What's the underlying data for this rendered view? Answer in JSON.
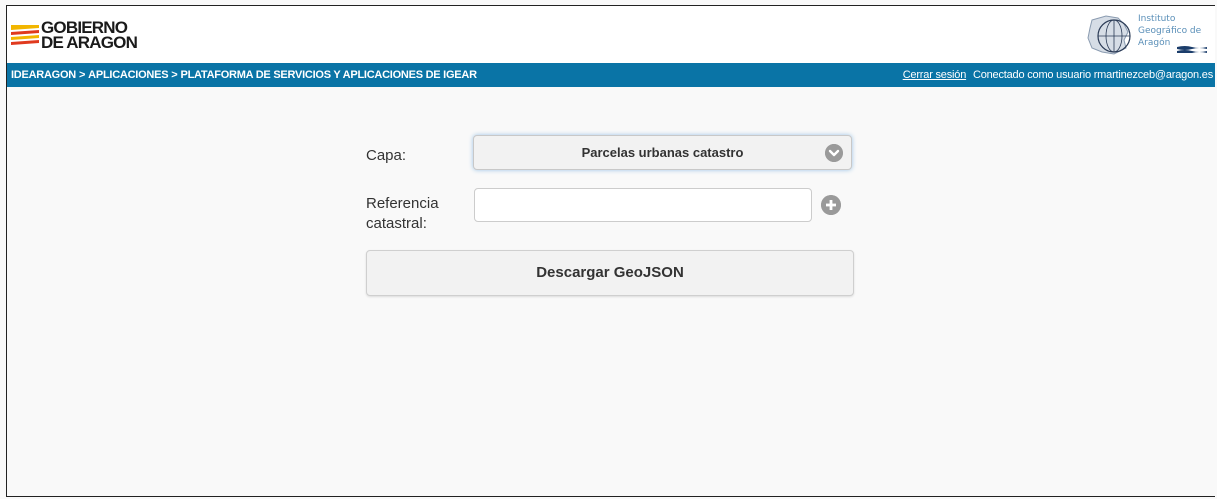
{
  "header": {
    "gov_logo": {
      "line1": "GOBIERNO",
      "line2": "DE ARAGON"
    },
    "igear_logo": {
      "line1": "Instituto",
      "line2": "Geográfico de",
      "line3": "Aragón"
    }
  },
  "navbar": {
    "breadcrumb": [
      {
        "label": "IDEARAGON"
      },
      {
        "label": "APLICACIONES"
      },
      {
        "label": "PLATAFORMA DE SERVICIOS Y APLICACIONES DE IGEAR"
      }
    ],
    "separator": ">",
    "logout_label": "Cerrar sesión",
    "connected_text": "Conectado como usuario rmartinezceb@aragon.es",
    "color": "#0a74a6"
  },
  "form": {
    "layer_label": "Capa:",
    "layer_selected": "Parcelas urbanas catastro",
    "ref_label_line1": "Referencia",
    "ref_label_line2": "catastral:",
    "ref_value": "",
    "download_label": "Descargar GeoJSON"
  },
  "icons": {
    "dropdown": "chevron-down-circle-icon",
    "add": "plus-circle-icon"
  }
}
